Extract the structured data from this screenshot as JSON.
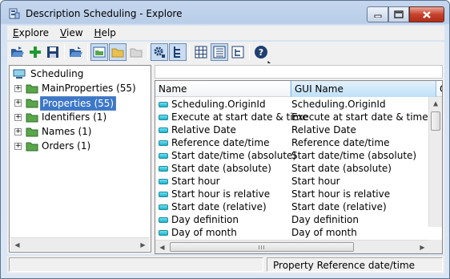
{
  "window": {
    "title": "Description Scheduling - Explore",
    "controls": {
      "minimize": "minimize-icon",
      "maximize": "maximize-icon",
      "close": "close-icon"
    }
  },
  "menu": [
    {
      "underline": "E",
      "rest": "xplore"
    },
    {
      "underline": "V",
      "rest": "iew"
    },
    {
      "underline": "H",
      "rest": "elp"
    }
  ],
  "toolbar": {
    "buttons": [
      "open-icon",
      "add-icon",
      "save-icon",
      "open-folder-icon",
      "tree-view-icon",
      "folder-view-icon",
      "new-folder-icon",
      "settings-icon",
      "hierarchy-icon",
      "large-icons-icon",
      "details-icon",
      "tree-list-icon",
      "help-icon"
    ]
  },
  "tree": {
    "root": "Scheduling",
    "items": [
      "MainProperties (55)",
      "Properties (55)",
      "Identifiers (1)",
      "Names (1)",
      "Orders (1)"
    ]
  },
  "list": {
    "columns": [
      "Name",
      "GUI Name",
      "Or"
    ],
    "rows": [
      {
        "name": "Scheduling.OriginId",
        "gui": "Scheduling.OriginId"
      },
      {
        "name": "Execute at start date & time",
        "gui": "Execute at start date & time"
      },
      {
        "name": "Relative Date",
        "gui": "Relative Date"
      },
      {
        "name": "Reference date/time",
        "gui": "Reference date/time"
      },
      {
        "name": "Start date/time (absolute)",
        "gui": "Start date/time (absolute)"
      },
      {
        "name": "Start date (absolute)",
        "gui": "Start date (absolute)"
      },
      {
        "name": "Start hour",
        "gui": "Start hour"
      },
      {
        "name": "Start hour is relative",
        "gui": "Start hour is relative"
      },
      {
        "name": "Start date (relative)",
        "gui": "Start date (relative)"
      },
      {
        "name": "Day definition",
        "gui": "Day definition"
      },
      {
        "name": "Day of month",
        "gui": "Day of month"
      }
    ]
  },
  "status": {
    "left": "",
    "right": "Property Reference date/time"
  },
  "colors": {
    "selection": "#cfe3fb",
    "accent": "#1fb3cc",
    "folder": "#5aa64a"
  }
}
